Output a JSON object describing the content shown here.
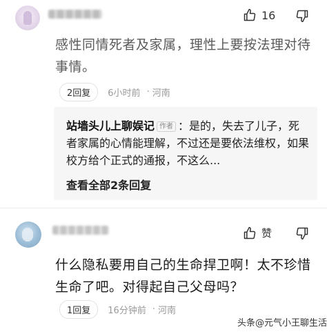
{
  "comment1": {
    "text": "感性同情死者及家属，理性上要按法理对待事情。",
    "likes": "16",
    "reply_button": "2回复",
    "time": "6小时前",
    "location": "河南",
    "dot": "·",
    "reply": {
      "author": "站墙头儿上聊娱记",
      "author_tag": "作者",
      "text": "：是的，失去了儿子，死者家属的心情能理解，不过还是要依法维权，如果校方给个正式的通报，不这么...",
      "view_all": "查看全部2条回复"
    }
  },
  "comment2": {
    "text": "什么隐私要用自己的生命捍卫啊！太不珍惜生命了吧。对得起自己父母吗？",
    "like_label": "赞",
    "reply_button": "1回复",
    "time": "16分钟前",
    "location": "河南",
    "dot": "·"
  },
  "watermark": "头条@元气小王聊生活",
  "icons": {
    "like": "thumbs-up-icon",
    "dislike": "thumbs-down-icon"
  }
}
